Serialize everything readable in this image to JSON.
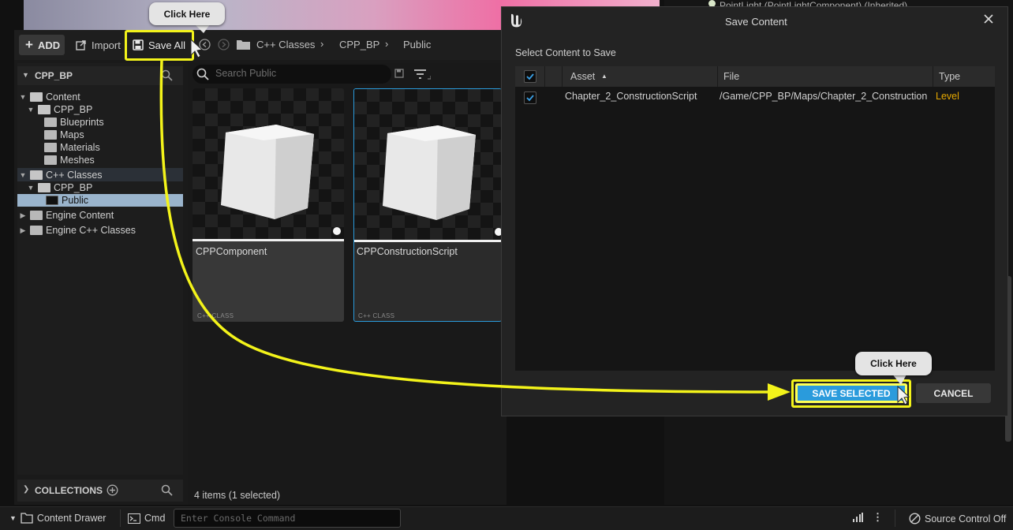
{
  "details": {
    "component_line": "PointLight (PointLightComponent) (Inherited)"
  },
  "content_browser": {
    "toolbar": {
      "add_label": "ADD",
      "import_label": "Import",
      "save_all_label": "Save All"
    },
    "breadcrumb": [
      "C++ Classes",
      "CPP_BP",
      "Public"
    ],
    "tree": {
      "header": "CPP_BP",
      "items": [
        {
          "label": "Content"
        },
        {
          "label": "CPP_BP"
        },
        {
          "label": "Blueprints"
        },
        {
          "label": "Maps"
        },
        {
          "label": "Materials"
        },
        {
          "label": "Meshes"
        },
        {
          "label": "C++ Classes"
        },
        {
          "label": "CPP_BP"
        },
        {
          "label": "Public"
        },
        {
          "label": "Engine Content"
        },
        {
          "label": "Engine C++ Classes"
        }
      ]
    },
    "collections_label": "COLLECTIONS",
    "search_placeholder": "Search Public",
    "assets": [
      {
        "name": "CPPComponent",
        "type": "C++ CLASS"
      },
      {
        "name": "CPPConstructionScript",
        "type": "C++ CLASS"
      }
    ],
    "status": "4 items (1 selected)"
  },
  "bottom_bar": {
    "content_drawer": "Content Drawer",
    "cmd": "Cmd",
    "console_placeholder": "Enter Console Command",
    "source_control": "Source Control Off"
  },
  "dialog": {
    "title": "Save Content",
    "subtitle": "Select Content to Save",
    "columns": [
      "Asset",
      "File",
      "Type"
    ],
    "rows": [
      {
        "checked": true,
        "asset": "Chapter_2_ConstructionScript",
        "file": "/Game/CPP_BP/Maps/Chapter_2_Construction",
        "type": "Level"
      }
    ],
    "save_selected_label": "SAVE SELECTED",
    "cancel_label": "CANCEL"
  },
  "annotations": {
    "bubble_1": "Click Here",
    "bubble_2": "Click Here",
    "highlight_color": "#f3f31a"
  },
  "colors": {
    "accent": "#2a9bdc",
    "type_level": "#e6a800",
    "checkbox_check": "#3aa0e6"
  }
}
